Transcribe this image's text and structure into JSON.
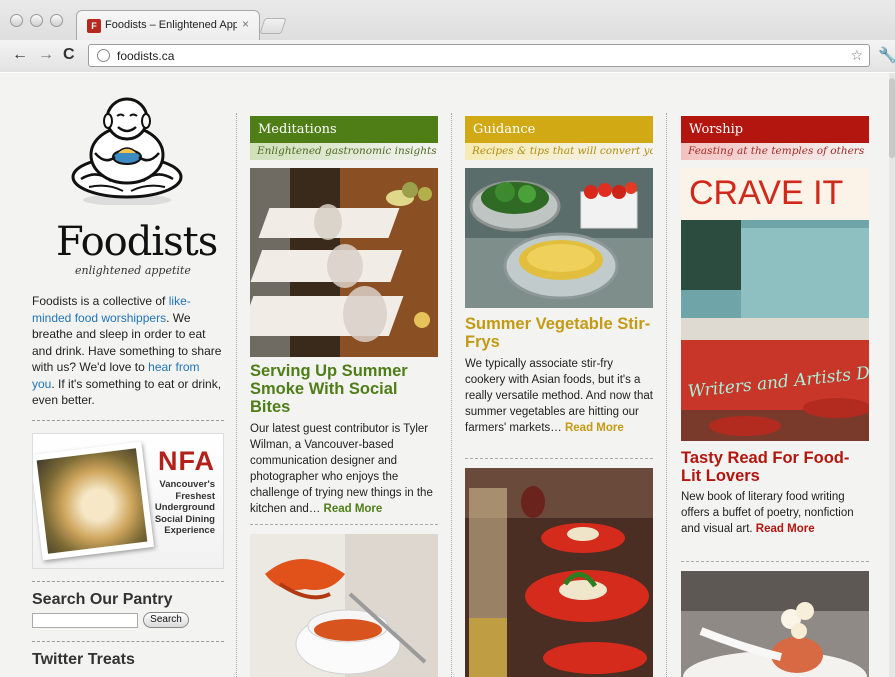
{
  "browser": {
    "tab_title": "Foodists – Enlightened Appe",
    "tab_close": "×",
    "url": "foodists.ca",
    "icons": [
      "back-arrow-icon",
      "forward-arrow-icon",
      "reload-icon",
      "globe-icon",
      "star-icon",
      "wrench-icon"
    ]
  },
  "sidebar": {
    "logo_name": "Foodists",
    "tagline": "enlightened appetite",
    "intro_text_1": "Foodists is a collective of ",
    "intro_link_1": "like-minded food worshippers",
    "intro_text_2": ". We breathe and sleep in order to eat and drink. Have something to share with us? We'd love to ",
    "intro_link_2": "hear from you",
    "intro_text_3": ". If it's something to eat or drink, even better.",
    "nfa": {
      "title": "NFA",
      "text": "Vancouver's Freshest Underground Social Dining Experience"
    },
    "search_heading": "Search Our Pantry",
    "search_value": "",
    "search_button": "Search",
    "twitter_heading": "Twitter Treats"
  },
  "columns": [
    {
      "category": "Meditations",
      "subtitle": "Enlightened gastronomic insights",
      "article_title": "Serving Up Summer Smoke With Social Bites",
      "article_body": "Our latest guest contributor is Tyler Wilman, a Vancouver-based communication designer and photographer who enjoys the challenge of trying new things in the kitchen and… ",
      "read_more": "Read More"
    },
    {
      "category": "Guidance",
      "subtitle": "Recipes & tips that will convert you",
      "article_title": "Summer Vegetable Stir-Frys",
      "article_body": "We typically associate stir-fry cookery with Asian foods, but it's a really versatile method. And now that summer vegetables are hitting our farmers' markets… ",
      "read_more": "Read More"
    },
    {
      "category": "Worship",
      "subtitle": "Feasting at the temples of others",
      "photo_sign": "CRAVE IT",
      "photo_neon": "Writers and Artists Do Food",
      "article_title": "Tasty Read For Food-Lit Lovers",
      "article_body": "New book of literary food writing offers a buffet of poetry, nonfiction and visual art. ",
      "read_more": "Read More"
    }
  ],
  "colors": {
    "meditations": "#4f7e17",
    "guidance": "#d0a914",
    "worship": "#b3160f",
    "link": "#1f75b8"
  }
}
